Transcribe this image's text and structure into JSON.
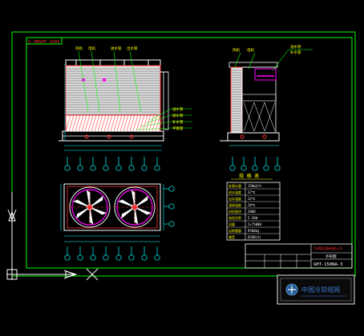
{
  "drawing": {
    "model_tag": "GHT-150NA-3",
    "elev_title": "S-VMGHT-150S",
    "spec_table_title": "规 格 表",
    "front_labels": [
      "风机",
      "电机",
      "进水管",
      "出水管",
      "溢水管",
      "排水管",
      "补水管",
      "平衡管"
    ],
    "side_labels": [
      "风机",
      "电机",
      "进水管",
      "补水管"
    ],
    "spec_rows": [
      [
        "处理水量",
        "150m3/h"
      ],
      [
        "进水温度",
        "37℃"
      ],
      [
        "出水温度",
        "32℃"
      ],
      [
        "湿球温度",
        "28℃"
      ],
      [
        "风机直径",
        "2800"
      ],
      [
        "电机功率",
        "5.5kW"
      ],
      [
        "风量",
        "2×75000"
      ],
      [
        "运转重量",
        "9500kg"
      ],
      [
        "噪音",
        "65dB(A)"
      ]
    ],
    "title_block": {
      "company": "冷却塔设备有限公司",
      "drawing_name": "外形图",
      "drawing_no": "GHT-150NA-3"
    },
    "logo_text": "中国冷却塔网"
  },
  "colors": {
    "background": "#000000",
    "frame": "#00ff00",
    "structure": "#ff3030",
    "dimension": "#00ffff",
    "fill": "#ffffff",
    "accent": "#ff00ff"
  }
}
